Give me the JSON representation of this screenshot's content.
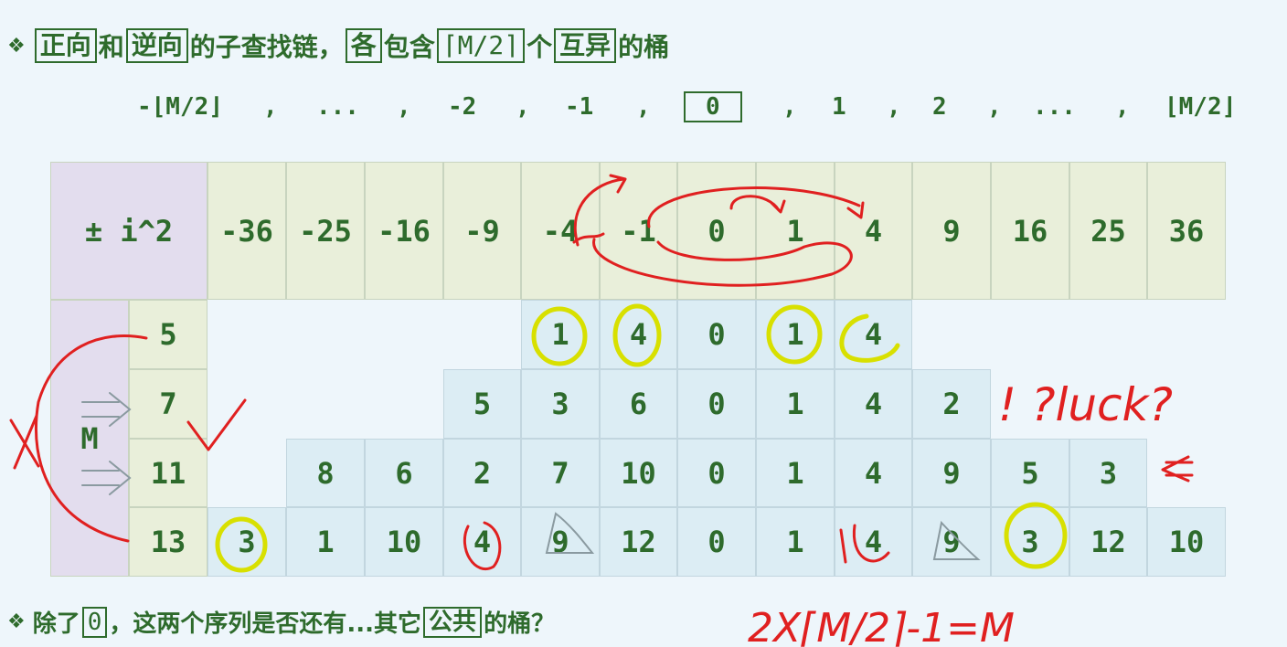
{
  "heading": {
    "marker": "❖",
    "p1": "正向",
    "p2": "和",
    "p3": "逆向",
    "p4": "的子查找链，",
    "p5": "各",
    "p6": "包含",
    "p7": "⌈M/2⌉",
    "p8": "个",
    "p9": "互异",
    "p10": "的桶"
  },
  "sequence": {
    "items": [
      "-⌊M/2⌋",
      ",",
      "...",
      ",",
      "-2",
      ",",
      "-1",
      ",",
      "0",
      ",",
      "1",
      ",",
      "2",
      ",",
      "...",
      ",",
      "⌊M/2⌋"
    ]
  },
  "table": {
    "corner": "± i^2",
    "headers": [
      "-36",
      "-25",
      "-16",
      "-9",
      "-4",
      "-1",
      "0",
      "1",
      "4",
      "9",
      "16",
      "25",
      "36"
    ],
    "m_label": "M",
    "rows": [
      {
        "m": "5",
        "values": [
          "1",
          "4",
          "0",
          "1",
          "4"
        ]
      },
      {
        "m": "7",
        "values": [
          "5",
          "3",
          "6",
          "0",
          "1",
          "4",
          "2"
        ]
      },
      {
        "m": "11",
        "values": [
          "8",
          "6",
          "2",
          "7",
          "10",
          "0",
          "1",
          "4",
          "9",
          "5",
          "3"
        ]
      },
      {
        "m": "13",
        "values": [
          "3",
          "1",
          "10",
          "4",
          "9",
          "12",
          "0",
          "1",
          "4",
          "9",
          "3",
          "12",
          "10"
        ]
      }
    ]
  },
  "footer": {
    "marker": "❖",
    "p1": "除了",
    "p2": "0",
    "p3": "，这两个序列是否还有...其它",
    "p4": "公共",
    "p5": "的桶？"
  },
  "handwriting": {
    "luck": "! ?luck?",
    "formula": "2X⌈M/2⌉-1=M"
  },
  "colors": {
    "text_green": "#2e6b2c",
    "header_bg": "#e9efda",
    "cell_bg": "#dcedf4",
    "m_col_bg": "#e3ddee",
    "ink_red": "#e02020",
    "highlight_yellow": "#d8e000"
  }
}
